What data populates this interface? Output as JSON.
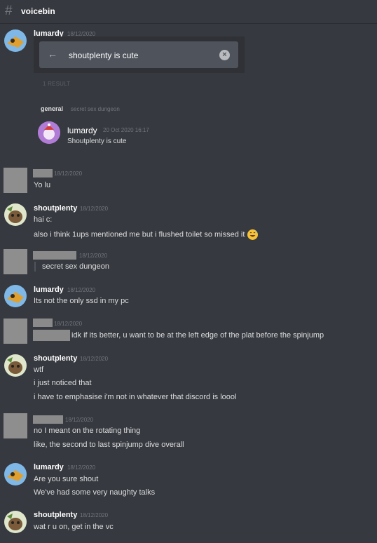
{
  "channel": {
    "name": "voicebin"
  },
  "search": {
    "query": "shoutplenty is cute",
    "result_count": "1 RESULT",
    "result": {
      "channel": "general",
      "topic": "secret sex dungeon",
      "author": "lumardy",
      "timestamp": "20 Oct 2020 16:17",
      "text": "Shoutplenty is cute"
    }
  },
  "messages": [
    {
      "author": "lumardy",
      "timestamp": "18/12/2020",
      "lines": []
    },
    {
      "author": "",
      "timestamp": "18/12/2020",
      "lines": [
        "Yo lu"
      ]
    },
    {
      "author": "shoutplenty",
      "timestamp": "18/12/2020",
      "lines": [
        "hai c:",
        "also i think 1ups mentioned me but i flushed toilet so missed it"
      ]
    },
    {
      "author": "",
      "timestamp": "18/12/2020",
      "lines": [
        "secret sex dungeon"
      ]
    },
    {
      "author": "lumardy",
      "timestamp": "18/12/2020",
      "lines": [
        "Its not the only ssd in my pc"
      ]
    },
    {
      "author": "",
      "timestamp": "18/12/2020",
      "lines": [
        "idk if its better, u want  to be at the left edge of the plat before the spinjump"
      ]
    },
    {
      "author": "shoutplenty",
      "timestamp": "18/12/2020",
      "lines": [
        "wtf",
        "i just noticed that",
        "i have to emphasise i'm not in whatever that discord is loool"
      ]
    },
    {
      "author": "",
      "timestamp": "18/12/2020",
      "lines": [
        "no I meant on the rotating thing",
        "like, the second to last spinjump dive overall"
      ]
    },
    {
      "author": "lumardy",
      "timestamp": "18/12/2020",
      "lines": [
        "Are you sure shout",
        "We've had some very naughty talks"
      ]
    },
    {
      "author": "shoutplenty",
      "timestamp": "18/12/2020",
      "lines": [
        "wat r u on, get in the vc"
      ]
    }
  ],
  "icons": {
    "channel": "hash-icon",
    "back": "arrow-left-icon",
    "clear": "close-icon",
    "emoji": "grinning-sweat-emoji"
  }
}
